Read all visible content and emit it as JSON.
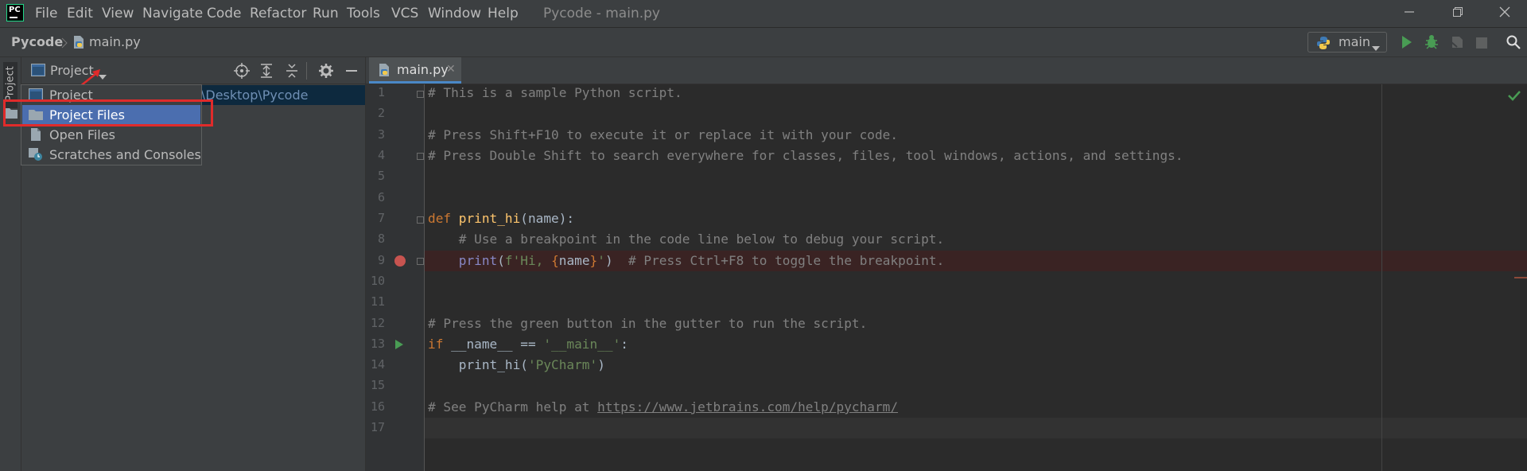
{
  "titlebar": {
    "menu": [
      "File",
      "Edit",
      "View",
      "Navigate",
      "Code",
      "Refactor",
      "Run",
      "Tools",
      "VCS",
      "Window",
      "Help"
    ],
    "window_title": "Pycode - main.py",
    "controls": [
      "minimize-icon",
      "restore-icon",
      "close-icon"
    ]
  },
  "navbar": {
    "project": "Pycode",
    "file": "main.py",
    "run_config": "main",
    "toolbar_icons": [
      "run-icon",
      "debug-icon",
      "coverage-icon",
      "stop-icon",
      "search-icon"
    ]
  },
  "tool_stripe": {
    "project_label": "Project"
  },
  "project_panel": {
    "title": "Project",
    "root_path_fragment": "\\Desktop\\Pycode",
    "header_icons": [
      "locate-icon",
      "expand-all-icon",
      "collapse-all-icon",
      "gear-icon",
      "minimize-panel-icon"
    ]
  },
  "view_popup": {
    "items": [
      {
        "label": "Project",
        "icon": "project-view-icon",
        "selected": false
      },
      {
        "label": "Project Files",
        "icon": "folder-icon",
        "selected": true
      },
      {
        "label": "Open Files",
        "icon": "file-icon",
        "selected": false
      },
      {
        "label": "Scratches and Consoles",
        "icon": "scratches-icon",
        "selected": false
      }
    ]
  },
  "editor": {
    "tab": "main.py",
    "line_numbers": [
      "1",
      "2",
      "3",
      "4",
      "5",
      "6",
      "7",
      "8",
      "9",
      "10",
      "11",
      "12",
      "13",
      "14",
      "15",
      "16",
      "17"
    ],
    "lines": {
      "l1": "# This is a sample Python script.",
      "l3": "# Press Shift+F10 to execute it or replace it with your code.",
      "l4": "# Press Double Shift to search everywhere for classes, files, tool windows, actions, and settings.",
      "l7_kw": "def",
      "l7_fn": "print_hi",
      "l7_rest": "(name):",
      "l8": "    # Use a breakpoint in the code line below to debug your script.",
      "l9_fn": "print",
      "l9_open": "(",
      "l9_s1": "f'Hi, ",
      "l9_b1": "{",
      "l9_var": "name",
      "l9_b2": "}",
      "l9_s2": "'",
      "l9_close": ")  ",
      "l9_c": "# Press Ctrl+F8 to toggle the breakpoint.",
      "l12": "# Press the green button in the gutter to run the script.",
      "l13_kw": "if",
      "l13_mid": " __name__ == ",
      "l13_s": "'__main__'",
      "l13_end": ":",
      "l14_fn": "    print_hi(",
      "l14_s": "'PyCharm'",
      "l14_end": ")",
      "l16_c": "# See PyCharm help at ",
      "l16_url": "https://www.jetbrains.com/help/pycharm/"
    },
    "breakpoint_line": 9,
    "run_marker_line": 13,
    "inspection_status": "check-icon"
  },
  "colors": {
    "accent": "#4b6eaf",
    "annotation": "#e02b2b",
    "comment": "#808080",
    "keyword": "#cc7832",
    "function": "#ffc66d",
    "string": "#6a8759"
  }
}
